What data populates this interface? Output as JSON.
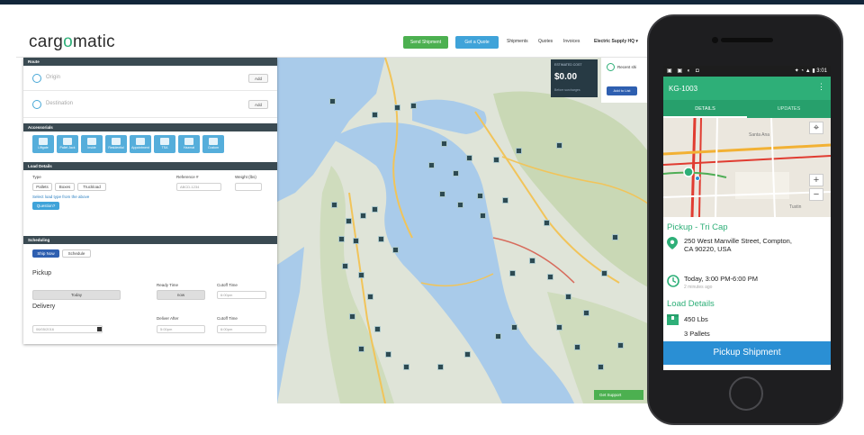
{
  "desktop": {
    "logo": {
      "pre": "carg",
      "o": "o",
      "post": "matic"
    },
    "header": {
      "send_shipment": "Send Shipment",
      "get_quote": "Get a Quote",
      "links": [
        "Shipments",
        "Quotes",
        "Invoices"
      ],
      "account": "Electric Supply HQ ▾"
    },
    "route": {
      "header": "Route",
      "origin_placeholder": "Origin",
      "destination_placeholder": "Destination",
      "add_label": "Add"
    },
    "accessorials": {
      "header": "Accessorials",
      "items": [
        "Liftgate",
        "Pallet Jack",
        "Inside",
        "Residential",
        "Appointment",
        "TSA",
        "Hazmat",
        "Custom"
      ]
    },
    "load": {
      "header": "Load Details",
      "type_label": "Type",
      "reference_label": "Reference #",
      "weight_label": "Weight (lbs)",
      "types": [
        "Pallets",
        "Boxes",
        "Truckload"
      ],
      "reference_placeholder": "ABCD-1234",
      "note": "Select load type from the above",
      "question_btn": "Question?"
    },
    "scheduling": {
      "header": "Scheduling",
      "ship_now": "Ship Now",
      "schedule": "Schedule",
      "pickup_title": "Pickup",
      "ready_time_label": "Ready Time",
      "cutoff_time_label": "Cutoff Time",
      "today_btn": "Today",
      "now_btn": "now",
      "cutoff_value": "6:00pm",
      "delivery_title": "Delivery",
      "deliver_after_label": "Deliver After",
      "delivery_cutoff_label": "Cutoff Time",
      "delivery_date": "06/05/2016",
      "deliver_after_value": "5:00pm",
      "delivery_cutoff_value": "6:00pm"
    },
    "cost": {
      "label": "ESTIMATED COST",
      "amount": "$0.00",
      "sub": "Before surcharges"
    },
    "recent": {
      "label": "Recent shi",
      "button": "Add to List"
    },
    "chat": "Get Support"
  },
  "phone": {
    "status_left": "▣ ▣ ◐ ◘",
    "status_right": "✦ ◔ ▲ ▮ 3:01",
    "title": "KG-1003",
    "menu": "⋮",
    "tabs": [
      "DETAILS",
      "UPDATES"
    ],
    "map_places": [
      "Santa Ana",
      "Tustin"
    ],
    "pickup_title": "Pickup - Tri Cap",
    "address_line1": "250 West Manville Street, Compton,",
    "address_line2": "CA 90220, USA",
    "time": "Today, 3:00 PM-6:00 PM",
    "time_ago": "2 minutes ago",
    "load_title": "Load Details",
    "weight": "450 Lbs",
    "pallets": "3 Pallets",
    "button": "Pickup Shipment"
  },
  "colors": {
    "brand_green": "#2eaf78",
    "button_blue": "#2a8fd4",
    "panel_header": "#3a4a52",
    "water": "#a9cbea"
  },
  "icons": [
    "location-pin-icon",
    "clock-icon",
    "box-icon",
    "crosshair-icon",
    "zoom-in-icon",
    "zoom-out-icon",
    "map-marker-icon"
  ]
}
